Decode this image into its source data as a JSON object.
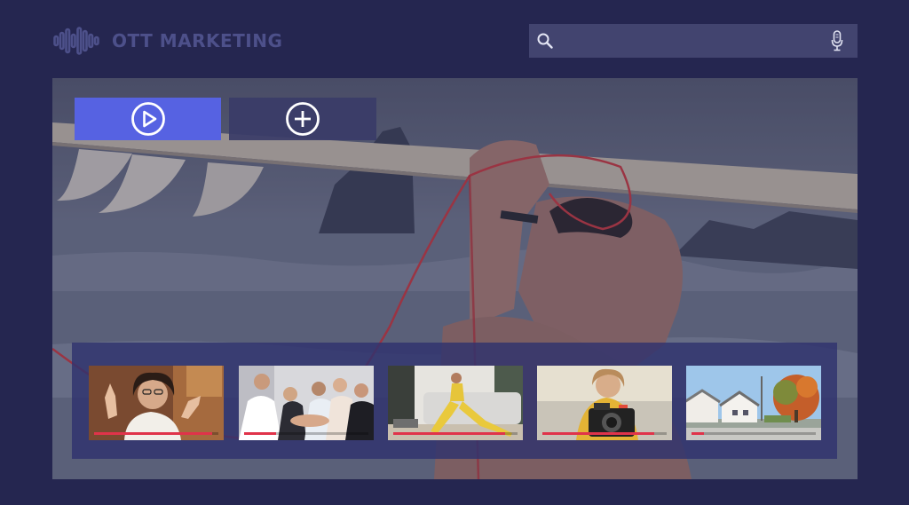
{
  "brand": {
    "name": "OTT MARKETING",
    "logo_icon": "soundwave-logo-icon"
  },
  "search": {
    "value": "",
    "placeholder": "",
    "icons": [
      "search-icon",
      "microphone-icon"
    ]
  },
  "hero": {
    "actions": {
      "play_icon": "play-circle-icon",
      "add_icon": "plus-circle-icon"
    }
  },
  "rail": {
    "items": [
      {
        "id": "video-call-woman",
        "progress": 0.95
      },
      {
        "id": "team-hands",
        "progress": 0.26
      },
      {
        "id": "fitness-lunge",
        "progress": 0.9
      },
      {
        "id": "camera-photographer",
        "progress": 0.9
      },
      {
        "id": "suburban-houses",
        "progress": 0.1
      }
    ]
  },
  "colors": {
    "background": "#252650",
    "accent": "#5662e2",
    "search_bg": "#42446f",
    "progress": "#e0334a",
    "logo": "#4d508a"
  }
}
